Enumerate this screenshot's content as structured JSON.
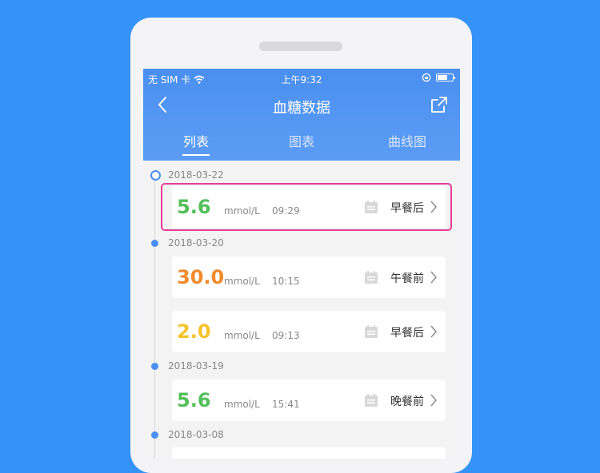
{
  "status_bar": {
    "carrier": "无 SIM 卡",
    "time": "上午9:32"
  },
  "nav": {
    "title": "血糖数据"
  },
  "tabs": [
    {
      "label": "列表",
      "active": true
    },
    {
      "label": "图表",
      "active": false
    },
    {
      "label": "曲线图",
      "active": false
    }
  ],
  "colors": {
    "accent": "#4a8ff0",
    "green": "#52c058",
    "orange": "#f08a2b",
    "yellow": "#f6c32c",
    "highlight": "#e63e97"
  },
  "groups": [
    {
      "date": "2018-03-22",
      "records": [
        {
          "value": "5.6",
          "value_color": "#52c058",
          "unit": "mmol/L",
          "time": "09:29",
          "meal": "早餐后",
          "highlighted": true
        }
      ]
    },
    {
      "date": "2018-03-20",
      "records": [
        {
          "value": "30.0",
          "value_color": "#f08a2b",
          "unit": "mmol/L",
          "time": "10:15",
          "meal": "午餐前"
        },
        {
          "value": "2.0",
          "value_color": "#f6c32c",
          "unit": "mmol/L",
          "time": "09:13",
          "meal": "早餐后"
        }
      ]
    },
    {
      "date": "2018-03-19",
      "records": [
        {
          "value": "5.6",
          "value_color": "#52c058",
          "unit": "mmol/L",
          "time": "15:41",
          "meal": "晚餐前"
        }
      ]
    },
    {
      "date": "2018-03-08",
      "records": []
    }
  ]
}
